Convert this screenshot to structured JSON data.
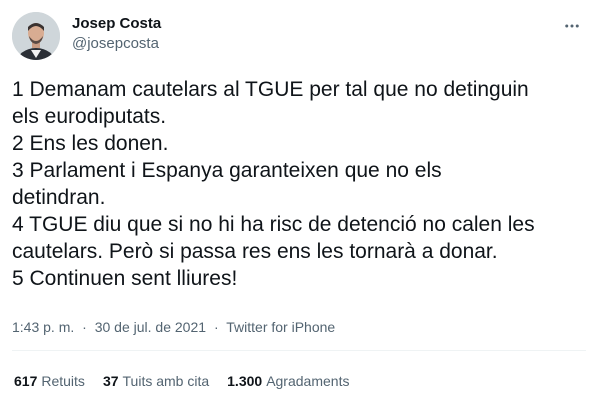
{
  "user": {
    "display_name": "Josep Costa",
    "handle": "@josepcosta",
    "avatar_icon": "user-avatar-photo"
  },
  "tweet": {
    "lines": [
      "1 Demanam cautelars al TGUE per tal que no detinguin",
      "els eurodiputats.",
      "2 Ens les donen.",
      "3 Parlament i Espanya garanteixen que no els",
      "detindran.",
      "4 TGUE diu que si no hi ha risc de detenció no calen les",
      "cautelars. Però si passa res ens les tornarà a donar.",
      "5 Continuen sent lliures!"
    ]
  },
  "meta": {
    "time": "1:43 p. m.",
    "separator": "·",
    "date": "30 de jul. de 2021",
    "source": "Twitter for iPhone"
  },
  "stats": {
    "retweets_count": "617",
    "retweets_label": "Retuits",
    "quotes_count": "37",
    "quotes_label": "Tuits amb cita",
    "likes_count": "1.300",
    "likes_label": "Agradaments"
  },
  "icons": {
    "more": "more-horizontal-icon"
  },
  "colors": {
    "text": "#0f1419",
    "secondary": "#536471",
    "divider": "#eff3f4"
  }
}
